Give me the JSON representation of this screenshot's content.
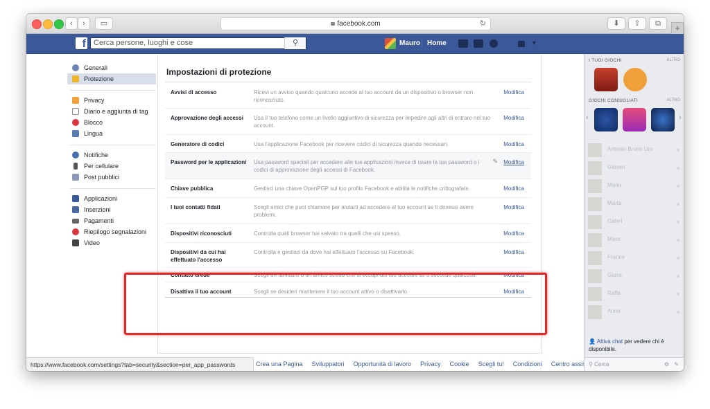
{
  "browser": {
    "url": "facebook.com",
    "status_url": "https://www.facebook.com/settings?tab=security&section=per_app_passwords"
  },
  "fb": {
    "search_placeholder": "Cerca persone, luoghi e cose",
    "user_name": "Mauro",
    "home_label": "Home"
  },
  "leftnav": {
    "group1": [
      {
        "label": "Generali",
        "icon": "gear-icon"
      },
      {
        "label": "Protezione",
        "icon": "shield-icon",
        "active": true
      }
    ],
    "group2": [
      {
        "label": "Privacy",
        "icon": "lock-icon"
      },
      {
        "label": "Diario e aggiunta di tag",
        "icon": "timeline-icon"
      },
      {
        "label": "Blocco",
        "icon": "block-icon"
      },
      {
        "label": "Lingua",
        "icon": "language-icon"
      }
    ],
    "group3": [
      {
        "label": "Notifiche",
        "icon": "globe-icon"
      },
      {
        "label": "Per cellulare",
        "icon": "mobile-icon"
      },
      {
        "label": "Post pubblici",
        "icon": "rss-icon"
      }
    ],
    "group4": [
      {
        "label": "Applicazioni",
        "icon": "apps-icon"
      },
      {
        "label": "Inserzioni",
        "icon": "ads-icon"
      },
      {
        "label": "Pagamenti",
        "icon": "card-icon"
      },
      {
        "label": "Riepilogo segnalazioni",
        "icon": "support-icon"
      },
      {
        "label": "Video",
        "icon": "video-icon"
      }
    ]
  },
  "main": {
    "title": "Impostazioni di protezione",
    "edit_label": "Modifica",
    "rows": [
      {
        "label": "Avvisi di accesso",
        "desc": "Ricevi un avviso quando qualcuno accede al tuo account da un dispositivo o browser non riconosciuto."
      },
      {
        "label": "Approvazione degli accessi",
        "desc": "Usa il tuo telefono come un livello aggiuntivo di sicurezza per impedire agli altri di entrare nel tuo account."
      },
      {
        "label": "Generatore di codici",
        "desc": "Usa l'applicazione Facebook per ricevere codici di sicurezza quando necessari."
      },
      {
        "label": "Password per le applicazioni",
        "desc": "Usa password speciali per accedere alle tue applicazioni invece di usare la tua password o i codici di approvazione degli accessi di Facebook."
      },
      {
        "label": "Chiave pubblica",
        "desc": "Gestisci una chiave OpenPGP sul tuo profilo Facebook e abilita le notifiche crittografate."
      },
      {
        "label": "I tuoi contatti fidati",
        "desc": "Scegli amici che puoi chiamare per aiutarti ad accedere al tuo account se ti dovessi avere problemi."
      },
      {
        "label": "Dispositivi riconosciuti",
        "desc": "Controlla quali browser hai salvato tra quelli che usi spesso."
      },
      {
        "label": "Dispositivi da cui hai effettuato l'accesso",
        "desc": "Controlla e gestisci da dove hai effettuato l'accesso su Facebook."
      },
      {
        "label": "Contatto erede",
        "desc": "Scegli un familiare o un amico stretto che si occupi del tuo account se ti succede qualcosa."
      },
      {
        "label": "Disattiva il tuo account",
        "desc": "Scegli se desideri mantenere il tuo account attivo o disattivarlo."
      }
    ]
  },
  "footer": {
    "links": [
      "Crea una Pagina",
      "Sviluppatori",
      "Opportunità di lavoro",
      "Privacy",
      "Cookie",
      "Scegli tu!",
      "Condizioni",
      "Centro assistenza"
    ]
  },
  "rightbar": {
    "games_header": "I TUOI GIOCHI",
    "more_label": "ALTRO",
    "suggested_header": "GIOCHI CONSIGLIATI",
    "friends": [
      "Antonio Bruno Um",
      "Giovan",
      "Maria",
      "Marta",
      "Cateri",
      "Mass",
      "France",
      "Giuse",
      "Raffa",
      "Anna"
    ],
    "chat_link": "Attiva chat",
    "chat_text": " per vedere chi è disponibile.",
    "chat_search_placeholder": "Cerca"
  },
  "colors": {
    "fb_blue": "#3b5998",
    "link": "#365899",
    "annotation_red": "#e02626"
  }
}
